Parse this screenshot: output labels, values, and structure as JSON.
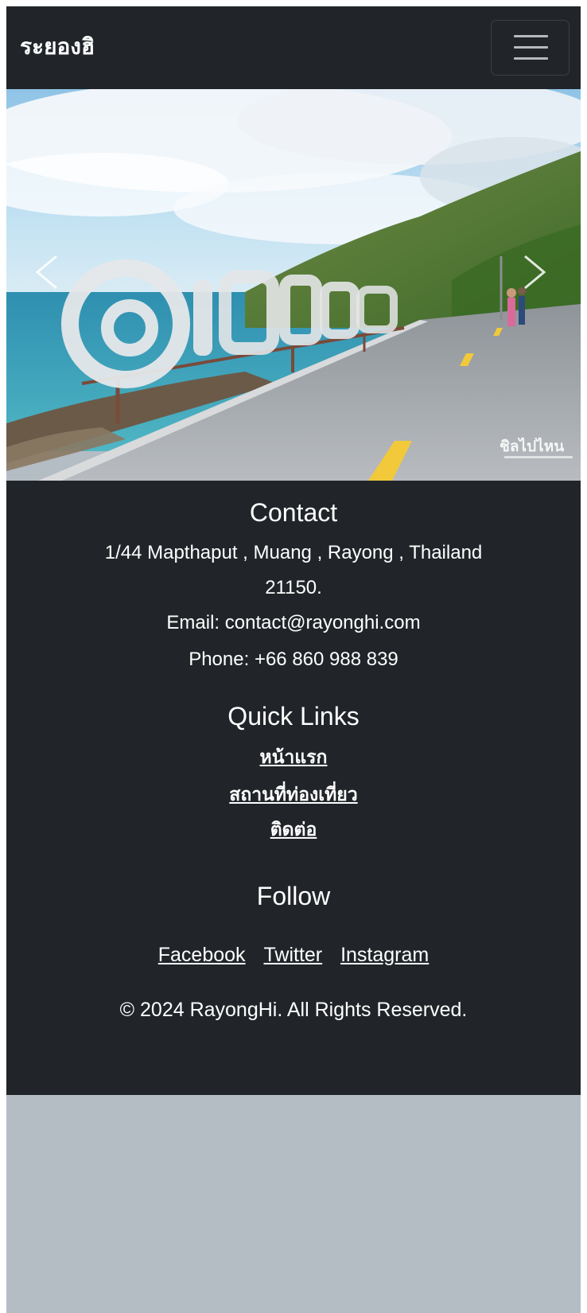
{
  "navbar": {
    "brand": "ระยองฮิ",
    "toggler_icon": "hamburger-menu-icon"
  },
  "carousel": {
    "prev_icon": "chevron-left-icon",
    "next_icon": "chevron-right-icon",
    "watermark": "ชิลไปไหน"
  },
  "footer": {
    "contact": {
      "heading": "Contact",
      "address_line1": "1/44 Mapthaput , Muang , Rayong , Thailand",
      "address_line2": "21150.",
      "email": "Email: contact@rayonghi.com",
      "phone": "Phone: +66 860 988 839"
    },
    "quick_links": {
      "heading": "Quick Links",
      "items": [
        {
          "label": "หน้าแรก"
        },
        {
          "label": "สถานที่ท่องเที่ยว"
        },
        {
          "label": "ติดต่อ"
        }
      ]
    },
    "follow": {
      "heading": "Follow",
      "links": [
        {
          "label": "Facebook"
        },
        {
          "label": "Twitter"
        },
        {
          "label": "Instagram"
        }
      ]
    },
    "copyright": "© 2024 RayongHi. All Rights Reserved."
  },
  "colors": {
    "dark": "#212529",
    "page_background": "#b4bcc4",
    "text": "#ffffff"
  }
}
